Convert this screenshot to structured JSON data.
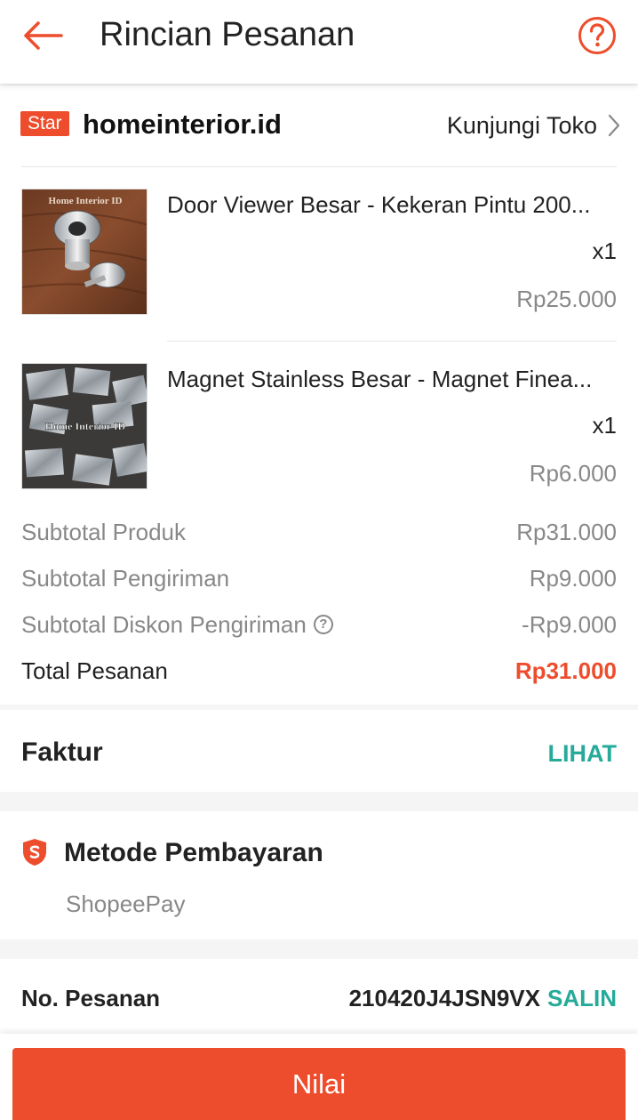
{
  "header": {
    "title": "Rincian Pesanan",
    "back_icon": "arrow-left-icon",
    "help_icon": "help-circle-icon"
  },
  "shop": {
    "badge": "Star",
    "name": "homeinterior.id",
    "visit_label": "Kunjungi Toko"
  },
  "products": [
    {
      "name": "Door Viewer Besar - Kekeran Pintu 200...",
      "qty": "x1",
      "price": "Rp25.000",
      "watermark": "Home Interior ID"
    },
    {
      "name": "Magnet Stainless Besar - Magnet Finea...",
      "qty": "x1",
      "price": "Rp6.000",
      "watermark": "Home Interior ID"
    }
  ],
  "summary": {
    "subtotal_product_label": "Subtotal Produk",
    "subtotal_product_value": "Rp31.000",
    "subtotal_shipping_label": "Subtotal Pengiriman",
    "subtotal_shipping_value": "Rp9.000",
    "shipping_discount_label": "Subtotal Diskon Pengiriman",
    "shipping_discount_value": "-Rp9.000",
    "total_label": "Total Pesanan",
    "total_value": "Rp31.000"
  },
  "invoice": {
    "label": "Faktur",
    "link": "LIHAT"
  },
  "payment": {
    "title": "Metode Pembayaran",
    "method": "ShopeePay"
  },
  "order": {
    "label": "No. Pesanan",
    "number": "210420J4JSN9VX",
    "copy_label": "SALIN"
  },
  "bottom": {
    "button_label": "Nilai"
  },
  "colors": {
    "accent": "#ee4d2d",
    "link": "#26aa99"
  }
}
